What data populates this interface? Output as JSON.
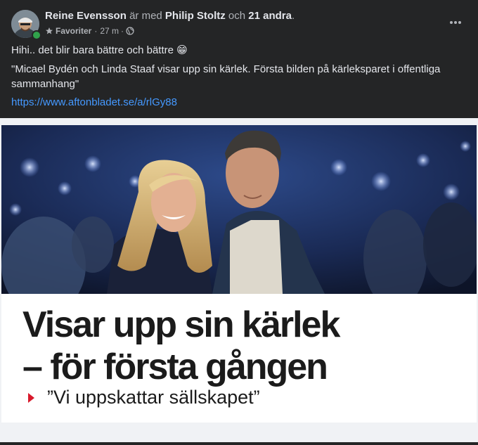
{
  "post": {
    "author": "Reine Evensson",
    "with_text": "är med",
    "tagged_person": "Philip Stoltz",
    "and_text": "och",
    "others": "21 andra",
    "period": ".",
    "audience_label": "Favoriter",
    "time": "27 m",
    "separator": "·",
    "more_icon": "more-options-icon",
    "text_line1": "Hihi.. det blir bara bättre och bättre 😁",
    "quote": "\"Micael Bydén och Linda Staaf visar upp sin kärlek. Första bilden på kärleksparet i offentliga sammanhang\"",
    "link": "https://www.aftonbladet.se/a/rlGy88"
  },
  "card": {
    "headline_line1": "Visar upp sin kärlek",
    "headline_line2": "– för första gången",
    "subheadline": "”Vi uppskattar sällskapet”"
  },
  "colors": {
    "header_bg": "#242526",
    "link": "#4599ff",
    "accent_red": "#d8192b"
  }
}
